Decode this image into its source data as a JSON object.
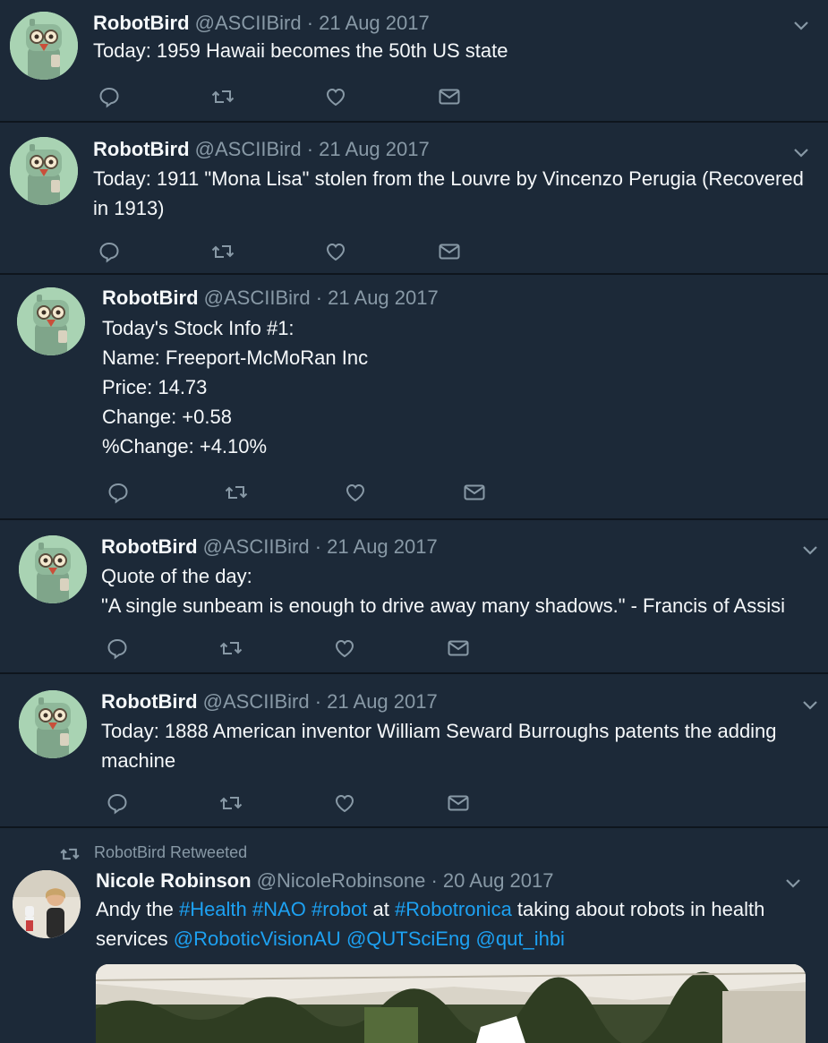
{
  "tweets": [
    {
      "name": "RobotBird",
      "handle": "@ASCIIBird",
      "sep": "·",
      "date": "21 Aug 2017",
      "text": "Today: 1959 Hawaii becomes the 50th US state"
    },
    {
      "name": "RobotBird",
      "handle": "@ASCIIBird",
      "sep": "·",
      "date": "21 Aug 2017",
      "text": "Today: 1911 \"Mona Lisa\" stolen from the Louvre by Vincenzo Perugia (Recovered\nin 1913)"
    },
    {
      "name": "RobotBird",
      "handle": "@ASCIIBird",
      "sep": "·",
      "date": "21 Aug 2017",
      "text": "Today's Stock Info #1:\nName: Freeport-McMoRan Inc\nPrice: 14.73\nChange: +0.58\n%Change: +4.10%"
    },
    {
      "name": "RobotBird",
      "handle": "@ASCIIBird",
      "sep": "·",
      "date": "21 Aug 2017",
      "text": "Quote of the day:\n\"A single sunbeam is enough to drive away many shadows.\" - Francis of Assisi"
    },
    {
      "name": "RobotBird",
      "handle": "@ASCIIBird",
      "sep": "·",
      "date": "21 Aug 2017",
      "text": "Today: 1888 American inventor William Seward Burroughs patents the adding\nmachine"
    }
  ],
  "retweet": {
    "label": "RobotBird Retweeted",
    "name": "Nicole Robinson",
    "handle": "@NicoleRobinsone",
    "sep": "·",
    "date": "20 Aug 2017",
    "text_parts": {
      "t1": "Andy the ",
      "h1": "#Health",
      "s1": " ",
      "h2": "#NAO",
      "s2": " ",
      "h3": "#robot",
      "t2": " at ",
      "h4": "#Robotronica",
      "t3": " taking about robots in health",
      "t4": "services ",
      "m1": "@RoboticVisionAU",
      "s3": " ",
      "m2": "@QUTSciEng",
      "s4": " ",
      "m3": "@qut_ihbi"
    }
  },
  "icons": {
    "reply": "reply-icon",
    "retweet": "retweet-icon",
    "like": "heart-icon",
    "dm": "envelope-icon",
    "caret": "chevron-down-icon"
  },
  "colors": {
    "background": "#1c2938",
    "text": "#f5f8fa",
    "muted": "#8899a6",
    "link": "#1da1f2"
  }
}
